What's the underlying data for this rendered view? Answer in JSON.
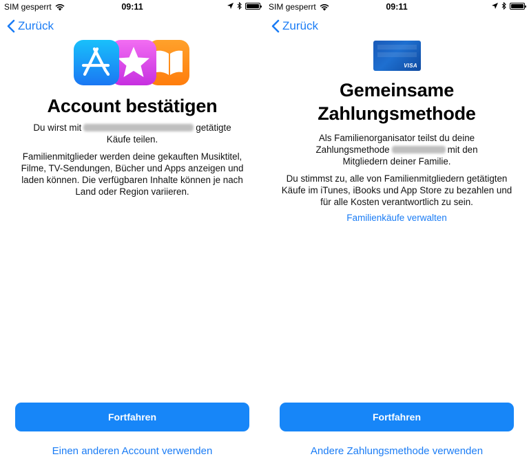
{
  "left": {
    "status": {
      "carrier": "SIM gesperrt",
      "time": "09:11"
    },
    "back_label": "Zurück",
    "title": "Account bestätigen",
    "para1_before": "Du wirst mit",
    "para1_after": "getätigte",
    "para1_line2": "Käufe teilen.",
    "para2": "Familienmitglieder werden deine gekauften Musiktitel, Filme, TV-Sendungen, Bücher und Apps anzeigen und laden können. Die verfügbaren Inhalte können je nach Land oder Region variieren.",
    "primary_button": "Fortfahren",
    "secondary_link": "Einen anderen Account verwenden",
    "icons": [
      "app-store-icon",
      "itunes-star-icon",
      "ibooks-icon"
    ]
  },
  "right": {
    "status": {
      "carrier": "SIM gesperrt",
      "time": "09:11"
    },
    "back_label": "Zurück",
    "card_label": "VISA",
    "title_line1": "Gemeinsame",
    "title_line2": "Zahlungsmethode",
    "para1_line1": "Als Familienorganisator teilst du deine",
    "para1_before": "Zahlungsmethode",
    "para1_after": "mit den",
    "para1_line3": "Mitgliedern deiner Familie.",
    "para2": "Du stimmst zu, alle von Familienmitgliedern getätigten Käufe im iTunes, iBooks und App Store zu bezahlen und für alle Kosten verantwortlich zu sein.",
    "manage_link": "Familienkäufe verwalten",
    "primary_button": "Fortfahren",
    "secondary_link": "Andere Zahlungsmethode verwenden"
  },
  "colors": {
    "accent": "#1a7cf5",
    "button": "#1786f8",
    "app_store": "#1a77f3",
    "itunes": "#c62fe0",
    "ibooks": "#ff7d0c",
    "card": "#1a5ab8"
  }
}
